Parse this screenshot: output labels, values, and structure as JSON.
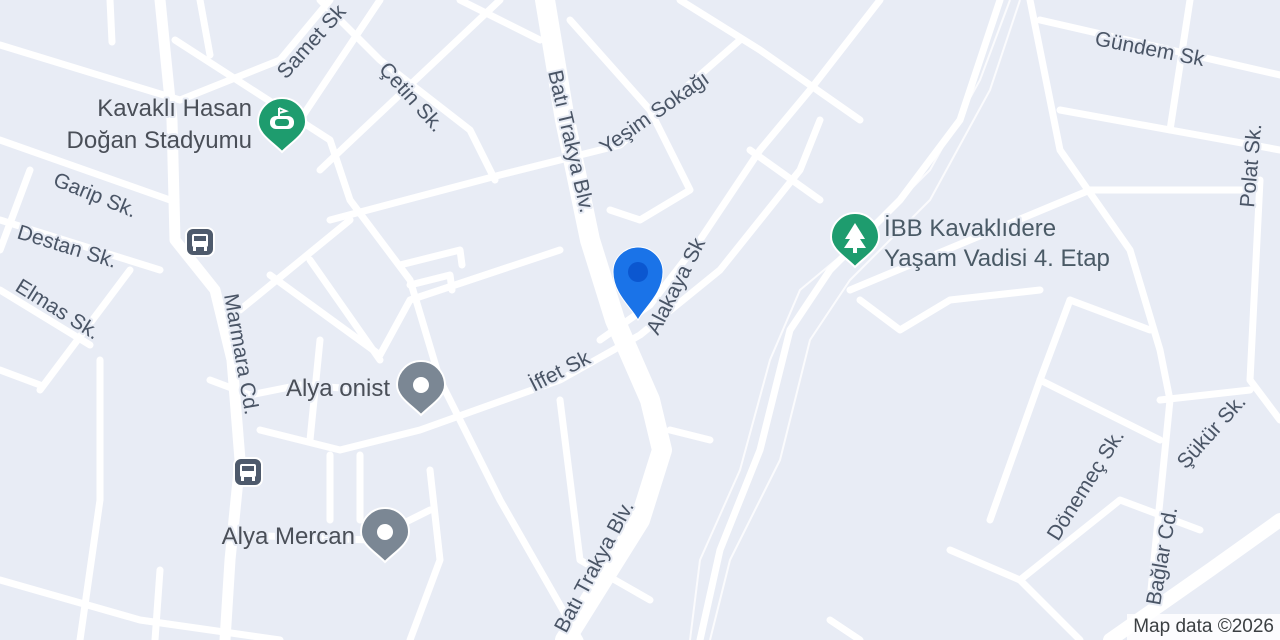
{
  "map": {
    "streets": {
      "samet": "Samet Sk",
      "cetin": "Çetin Sk.",
      "bati_trakya_upper": "Batı Trakya Blv.",
      "bati_trakya_lower": "Batı Trakya Blv.",
      "yesim": "Yeşim Sokağı",
      "gundem": "Gündem Sk",
      "polat": "Polat Sk.",
      "garip": "Garip Sk.",
      "destan": "Destan Sk.",
      "elmas": "Elmas Sk.",
      "marmara": "Marmara Cd.",
      "alakaya": "Alakaya Sk",
      "iffet": "İffet Sk",
      "donemec": "Dönemeç Sk.",
      "sukur": "Şükür Sk.",
      "baglar": "Bağlar Cd."
    },
    "places": {
      "stadium_line1": "Kavaklı Hasan",
      "stadium_line2": "Doğan Stadyumu",
      "park_line1": "İBB Kavaklıdere",
      "park_line2": "Yaşam Vadisi 4. Etap",
      "alya_onist": "Alya onist",
      "alya_mercan": "Alya Mercan"
    },
    "icons": {
      "stadium": "stadium-icon",
      "park": "tree-icon",
      "poi": "place-icon",
      "bus": "bus-stop-icon",
      "marker": "location-marker-icon"
    },
    "colors": {
      "background": "#e8ecf5",
      "road": "#ffffff",
      "park_pin": "#1e9c6e",
      "stadium_pin": "#1e9c6e",
      "poi_pin": "#7b8794",
      "bus_badge": "#4e5a6c",
      "marker": "#1a73e8",
      "marker_dot": "#0b57d0"
    }
  },
  "attribution": "Map data ©2026"
}
